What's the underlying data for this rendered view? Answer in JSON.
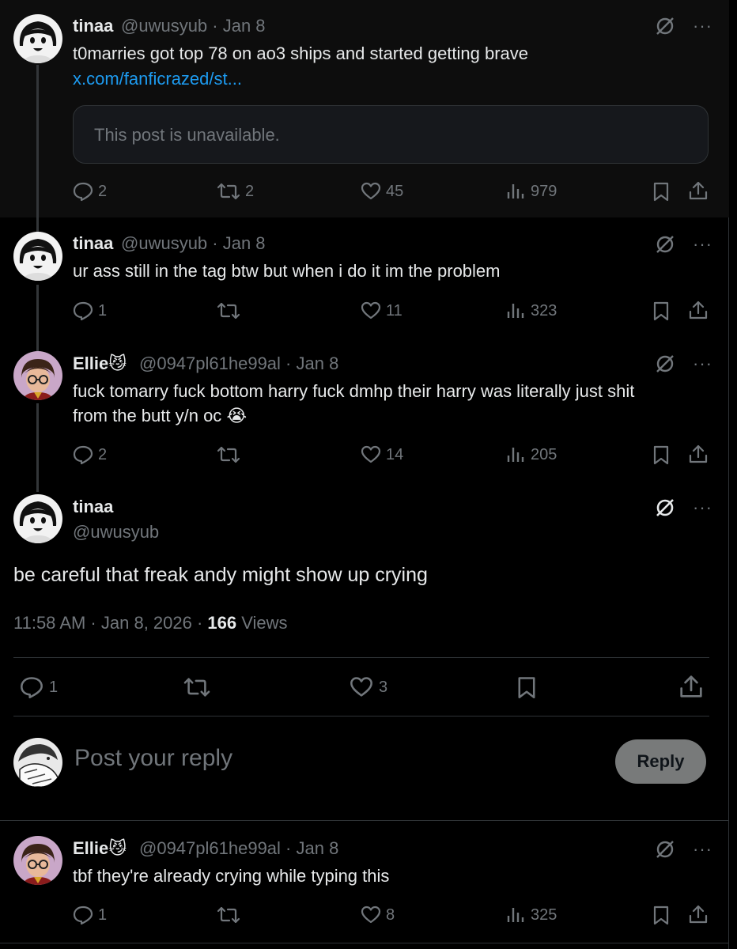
{
  "posts": [
    {
      "name": "tinaa",
      "handle": "@uwusyub · Jan 8",
      "text": "t0marries got top 78 on ao3 ships and started getting brave",
      "link": "x.com/fanficrazed/st...",
      "quote": "This post is unavailable.",
      "replies": "2",
      "reposts": "2",
      "likes": "45",
      "views": "979"
    },
    {
      "name": "tinaa",
      "handle": "@uwusyub · Jan 8",
      "text": "ur ass still in the tag btw but when i do it im the problem",
      "replies": "1",
      "reposts": "",
      "likes": "11",
      "views": "323"
    },
    {
      "name": "Ellie",
      "name_emoji": "😼",
      "handle": "@0947pl61he99al · Jan 8",
      "text_line1": "fuck tomarry fuck bottom harry fuck dmhp their harry was literally just shit",
      "text_line2": "from the butt y/n oc",
      "text_emoji": "😭",
      "replies": "2",
      "reposts": "",
      "likes": "14",
      "views": "205"
    }
  ],
  "main_post": {
    "name": "tinaa",
    "handle": "@uwusyub",
    "text": "be careful that freak andy might show up crying",
    "time": "11:58 AM · Jan 8, 2026 · ",
    "views_count": "166",
    "views_label": " Views",
    "replies": "1",
    "reposts": "",
    "likes": "3"
  },
  "reply_box": {
    "placeholder": "Post your reply",
    "button": "Reply"
  },
  "last_post": {
    "name": "Ellie",
    "name_emoji": "😼",
    "handle": "@0947pl61he99al · Jan 8",
    "text": "tbf they're already crying while typing this",
    "replies": "1",
    "reposts": "",
    "likes": "8",
    "views": "325"
  },
  "icons": {
    "more": "···"
  },
  "colors": {
    "background": "#000000",
    "text": "#e7e9ea",
    "muted": "#71767b",
    "link": "#1d9bf0",
    "border": "#2f3336"
  }
}
